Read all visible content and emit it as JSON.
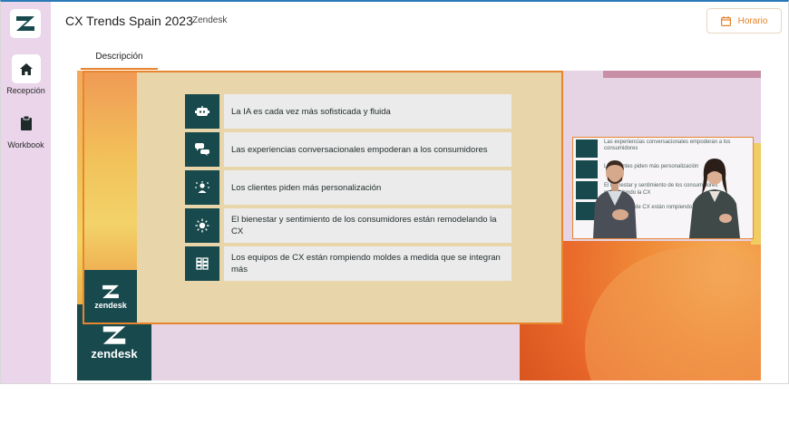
{
  "sidebar": {
    "logo_icon": "zendesk-logo-icon",
    "items": [
      {
        "label": "Recepción",
        "icon": "home-icon",
        "active": true
      },
      {
        "label": "Workbook",
        "icon": "clipboard-icon",
        "active": false
      }
    ]
  },
  "header": {
    "title": "CX Trends Spain 2023",
    "organizer": "Zendesk",
    "schedule_button": {
      "label": "Horario",
      "icon": "calendar-icon"
    }
  },
  "tabs": [
    {
      "label": "Descripción",
      "active": true
    }
  ],
  "video": {
    "brand_wordmark": "zendesk",
    "slide": {
      "brand_wordmark": "zendesk",
      "trends": [
        {
          "icon": "bot-icon",
          "text": "La IA es cada vez más sofisticada y fluida"
        },
        {
          "icon": "chat-bubbles-icon",
          "text": "Las experiencias conversacionales empoderan a los consumidores"
        },
        {
          "icon": "person-sparkle-icon",
          "text": "Los clientes piden más personalización"
        },
        {
          "icon": "sun-icon",
          "text": "El bienestar y sentimiento de los consumidores están remodelando la CX"
        },
        {
          "icon": "grid-blocks-icon",
          "text": "Los equipos de CX están rompiendo moldes a medida que se integran más"
        }
      ]
    },
    "inset_text": [
      "Las experiencias conversacionales empoderan a los",
      "consumidores",
      "Los clientes piden más personalización",
      "El bienestar y sentimiento de los consumidores",
      "remodelando la CX",
      "Los equipos de CX están rompiendo moldes"
    ]
  },
  "colors": {
    "sidebar_bg": "#ead5ea",
    "accent_orange": "#e4832a",
    "zendesk_green": "#17494d",
    "slide_bg": "#e8d5a9"
  }
}
